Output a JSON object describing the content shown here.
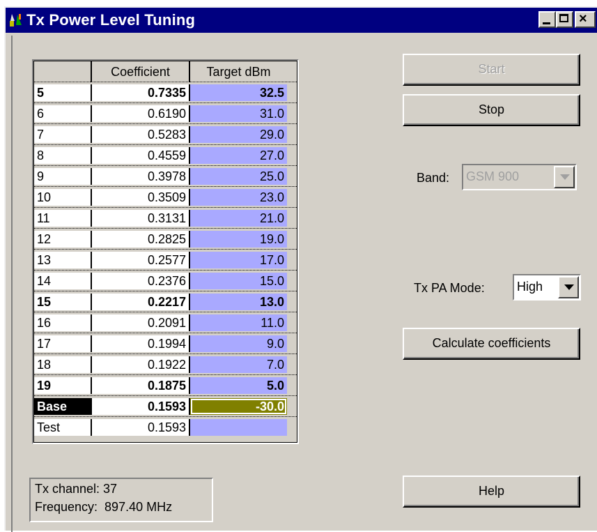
{
  "window": {
    "title": "Tx Power Level Tuning",
    "controls": {
      "minimize": "_",
      "maximize": "□",
      "close": "×"
    }
  },
  "grid": {
    "headers": [
      "",
      "Coefficient",
      "Target dBm"
    ],
    "rows": [
      {
        "label": "5",
        "coefficient": "0.7335",
        "target": "32.5",
        "bold": true
      },
      {
        "label": "6",
        "coefficient": "0.6190",
        "target": "31.0",
        "bold": false
      },
      {
        "label": "7",
        "coefficient": "0.5283",
        "target": "29.0",
        "bold": false
      },
      {
        "label": "8",
        "coefficient": "0.4559",
        "target": "27.0",
        "bold": false
      },
      {
        "label": "9",
        "coefficient": "0.3978",
        "target": "25.0",
        "bold": false
      },
      {
        "label": "10",
        "coefficient": "0.3509",
        "target": "23.0",
        "bold": false
      },
      {
        "label": "11",
        "coefficient": "0.3131",
        "target": "21.0",
        "bold": false
      },
      {
        "label": "12",
        "coefficient": "0.2825",
        "target": "19.0",
        "bold": false
      },
      {
        "label": "13",
        "coefficient": "0.2577",
        "target": "17.0",
        "bold": false
      },
      {
        "label": "14",
        "coefficient": "0.2376",
        "target": "15.0",
        "bold": false
      },
      {
        "label": "15",
        "coefficient": "0.2217",
        "target": "13.0",
        "bold": true
      },
      {
        "label": "16",
        "coefficient": "0.2091",
        "target": "11.0",
        "bold": false
      },
      {
        "label": "17",
        "coefficient": "0.1994",
        "target": "9.0",
        "bold": false
      },
      {
        "label": "18",
        "coefficient": "0.1922",
        "target": "7.0",
        "bold": false
      },
      {
        "label": "19",
        "coefficient": "0.1875",
        "target": "5.0",
        "bold": true
      },
      {
        "label": "Base",
        "coefficient": "0.1593",
        "target": "-30.0",
        "bold": true,
        "selected": true
      },
      {
        "label": "Test",
        "coefficient": "0.1593",
        "target": "",
        "bold": false
      }
    ]
  },
  "buttons": {
    "start": "Start",
    "stop": "Stop",
    "calculate": "Calculate coefficients",
    "help": "Help"
  },
  "band": {
    "label": "Band:",
    "value": "GSM 900",
    "enabled": false
  },
  "pa_mode": {
    "label": "Tx PA Mode:",
    "value": "High"
  },
  "info": {
    "channel": "Tx channel: 37",
    "frequency": "Frequency:  897.40 MHz"
  },
  "colors": {
    "titlebar": "#000080",
    "target_column": "#a9a9ff",
    "selected_target": "#808000",
    "face": "#d4d0c8"
  }
}
